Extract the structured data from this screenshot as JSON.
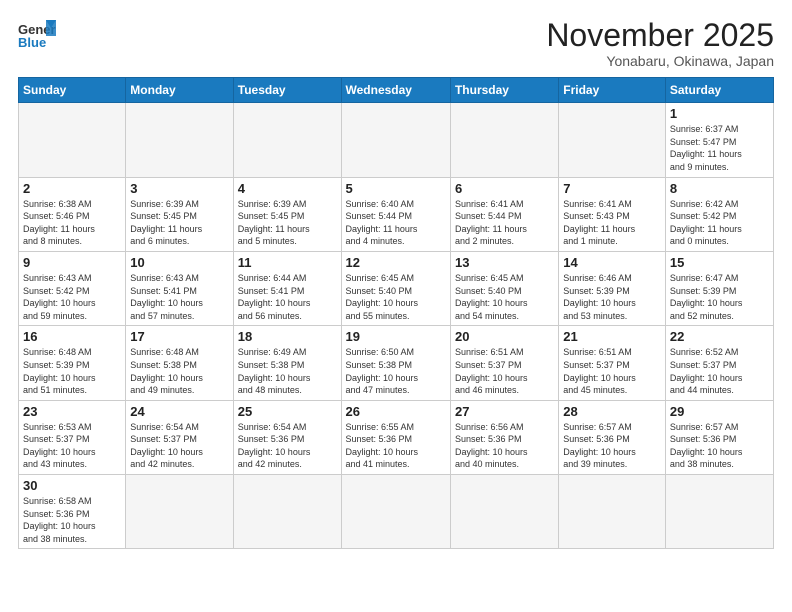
{
  "header": {
    "logo_general": "General",
    "logo_blue": "Blue",
    "month": "November 2025",
    "location": "Yonabaru, Okinawa, Japan"
  },
  "weekdays": [
    "Sunday",
    "Monday",
    "Tuesday",
    "Wednesday",
    "Thursday",
    "Friday",
    "Saturday"
  ],
  "weeks": [
    [
      {
        "day": "",
        "info": ""
      },
      {
        "day": "",
        "info": ""
      },
      {
        "day": "",
        "info": ""
      },
      {
        "day": "",
        "info": ""
      },
      {
        "day": "",
        "info": ""
      },
      {
        "day": "",
        "info": ""
      },
      {
        "day": "1",
        "info": "Sunrise: 6:37 AM\nSunset: 5:47 PM\nDaylight: 11 hours\nand 9 minutes."
      }
    ],
    [
      {
        "day": "2",
        "info": "Sunrise: 6:38 AM\nSunset: 5:46 PM\nDaylight: 11 hours\nand 8 minutes."
      },
      {
        "day": "3",
        "info": "Sunrise: 6:39 AM\nSunset: 5:45 PM\nDaylight: 11 hours\nand 6 minutes."
      },
      {
        "day": "4",
        "info": "Sunrise: 6:39 AM\nSunset: 5:45 PM\nDaylight: 11 hours\nand 5 minutes."
      },
      {
        "day": "5",
        "info": "Sunrise: 6:40 AM\nSunset: 5:44 PM\nDaylight: 11 hours\nand 4 minutes."
      },
      {
        "day": "6",
        "info": "Sunrise: 6:41 AM\nSunset: 5:44 PM\nDaylight: 11 hours\nand 2 minutes."
      },
      {
        "day": "7",
        "info": "Sunrise: 6:41 AM\nSunset: 5:43 PM\nDaylight: 11 hours\nand 1 minute."
      },
      {
        "day": "8",
        "info": "Sunrise: 6:42 AM\nSunset: 5:42 PM\nDaylight: 11 hours\nand 0 minutes."
      }
    ],
    [
      {
        "day": "9",
        "info": "Sunrise: 6:43 AM\nSunset: 5:42 PM\nDaylight: 10 hours\nand 59 minutes."
      },
      {
        "day": "10",
        "info": "Sunrise: 6:43 AM\nSunset: 5:41 PM\nDaylight: 10 hours\nand 57 minutes."
      },
      {
        "day": "11",
        "info": "Sunrise: 6:44 AM\nSunset: 5:41 PM\nDaylight: 10 hours\nand 56 minutes."
      },
      {
        "day": "12",
        "info": "Sunrise: 6:45 AM\nSunset: 5:40 PM\nDaylight: 10 hours\nand 55 minutes."
      },
      {
        "day": "13",
        "info": "Sunrise: 6:45 AM\nSunset: 5:40 PM\nDaylight: 10 hours\nand 54 minutes."
      },
      {
        "day": "14",
        "info": "Sunrise: 6:46 AM\nSunset: 5:39 PM\nDaylight: 10 hours\nand 53 minutes."
      },
      {
        "day": "15",
        "info": "Sunrise: 6:47 AM\nSunset: 5:39 PM\nDaylight: 10 hours\nand 52 minutes."
      }
    ],
    [
      {
        "day": "16",
        "info": "Sunrise: 6:48 AM\nSunset: 5:39 PM\nDaylight: 10 hours\nand 51 minutes."
      },
      {
        "day": "17",
        "info": "Sunrise: 6:48 AM\nSunset: 5:38 PM\nDaylight: 10 hours\nand 49 minutes."
      },
      {
        "day": "18",
        "info": "Sunrise: 6:49 AM\nSunset: 5:38 PM\nDaylight: 10 hours\nand 48 minutes."
      },
      {
        "day": "19",
        "info": "Sunrise: 6:50 AM\nSunset: 5:38 PM\nDaylight: 10 hours\nand 47 minutes."
      },
      {
        "day": "20",
        "info": "Sunrise: 6:51 AM\nSunset: 5:37 PM\nDaylight: 10 hours\nand 46 minutes."
      },
      {
        "day": "21",
        "info": "Sunrise: 6:51 AM\nSunset: 5:37 PM\nDaylight: 10 hours\nand 45 minutes."
      },
      {
        "day": "22",
        "info": "Sunrise: 6:52 AM\nSunset: 5:37 PM\nDaylight: 10 hours\nand 44 minutes."
      }
    ],
    [
      {
        "day": "23",
        "info": "Sunrise: 6:53 AM\nSunset: 5:37 PM\nDaylight: 10 hours\nand 43 minutes."
      },
      {
        "day": "24",
        "info": "Sunrise: 6:54 AM\nSunset: 5:37 PM\nDaylight: 10 hours\nand 42 minutes."
      },
      {
        "day": "25",
        "info": "Sunrise: 6:54 AM\nSunset: 5:36 PM\nDaylight: 10 hours\nand 42 minutes."
      },
      {
        "day": "26",
        "info": "Sunrise: 6:55 AM\nSunset: 5:36 PM\nDaylight: 10 hours\nand 41 minutes."
      },
      {
        "day": "27",
        "info": "Sunrise: 6:56 AM\nSunset: 5:36 PM\nDaylight: 10 hours\nand 40 minutes."
      },
      {
        "day": "28",
        "info": "Sunrise: 6:57 AM\nSunset: 5:36 PM\nDaylight: 10 hours\nand 39 minutes."
      },
      {
        "day": "29",
        "info": "Sunrise: 6:57 AM\nSunset: 5:36 PM\nDaylight: 10 hours\nand 38 minutes."
      }
    ],
    [
      {
        "day": "30",
        "info": "Sunrise: 6:58 AM\nSunset: 5:36 PM\nDaylight: 10 hours\nand 38 minutes."
      },
      {
        "day": "",
        "info": ""
      },
      {
        "day": "",
        "info": ""
      },
      {
        "day": "",
        "info": ""
      },
      {
        "day": "",
        "info": ""
      },
      {
        "day": "",
        "info": ""
      },
      {
        "day": "",
        "info": ""
      }
    ]
  ]
}
